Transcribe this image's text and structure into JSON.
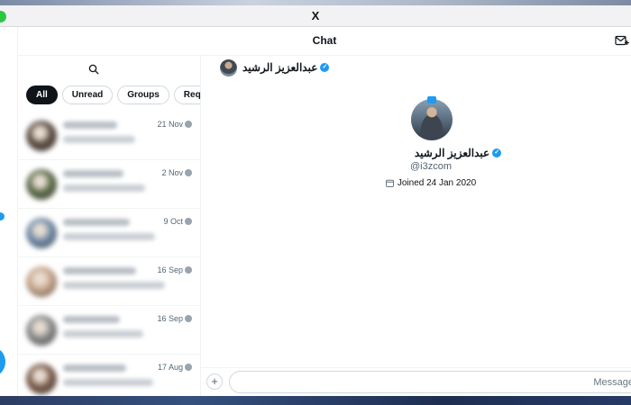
{
  "window": {
    "title": "X"
  },
  "header": {
    "title": "Chat",
    "new_chat_icon": "new-message-icon"
  },
  "search": {
    "icon": "search-icon"
  },
  "filters": [
    "All",
    "Unread",
    "Groups",
    "Requests"
  ],
  "conversations": [
    {
      "date": "21 Nov",
      "tone": "#5a4a40"
    },
    {
      "date": "2 Nov",
      "tone": "#5b6b48"
    },
    {
      "date": "9 Oct",
      "tone": "#6e8aa8"
    },
    {
      "date": "16 Sep",
      "tone": "#c9a68a"
    },
    {
      "date": "16 Sep",
      "tone": "#8a8a8a"
    },
    {
      "date": "17 Aug",
      "tone": "#7a5a48"
    }
  ],
  "chat": {
    "header_name": "عبدالعزيز الرشيد",
    "profile": {
      "name": "عبدالعزيز الرشيد",
      "handle": "@i3zcom",
      "joined": "Joined 24 Jan 2020"
    },
    "composer_placeholder": "Message"
  },
  "colors": {
    "accent": "#1d9bf0",
    "text": "#0f1419",
    "muted": "#536471"
  }
}
